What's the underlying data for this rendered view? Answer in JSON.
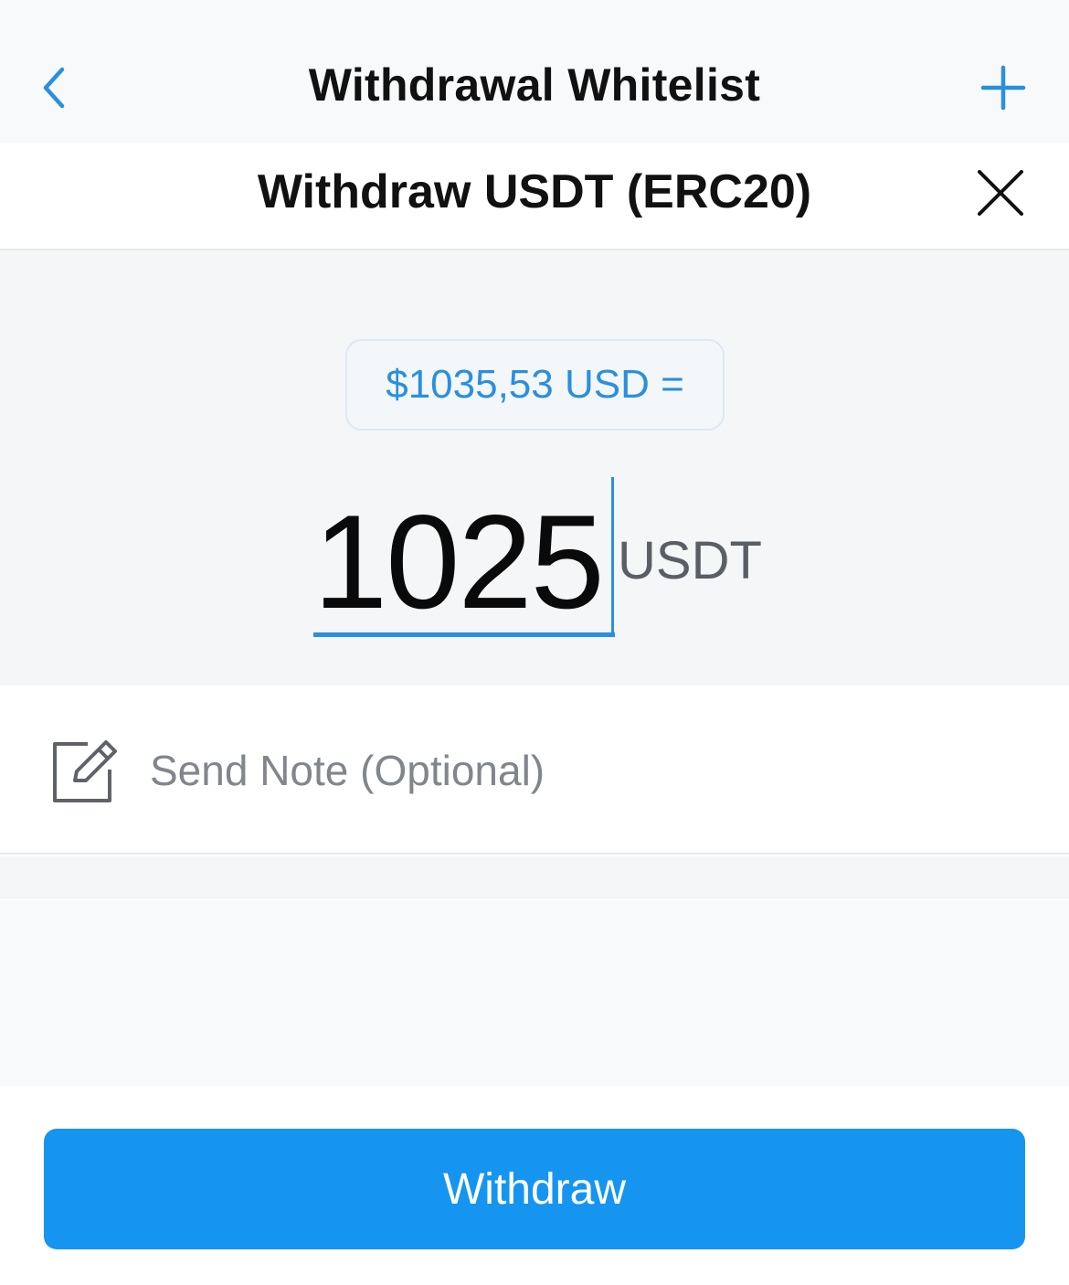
{
  "nav": {
    "title": "Withdrawal Whitelist",
    "back_icon": "chevron-left-icon",
    "add_icon": "plus-icon"
  },
  "sheet": {
    "title": "Withdraw USDT (ERC20)",
    "close_icon": "close-icon"
  },
  "amount": {
    "usd_equivalent": "$1035,53 USD =",
    "value": "1025",
    "unit": "USDT"
  },
  "note": {
    "icon": "edit-note-icon",
    "placeholder": "Send Note (Optional)"
  },
  "actions": {
    "withdraw_label": "Withdraw"
  },
  "colors": {
    "accent": "#1595f0",
    "link": "#2a8fe0",
    "background_gray": "#f4f6f8"
  }
}
